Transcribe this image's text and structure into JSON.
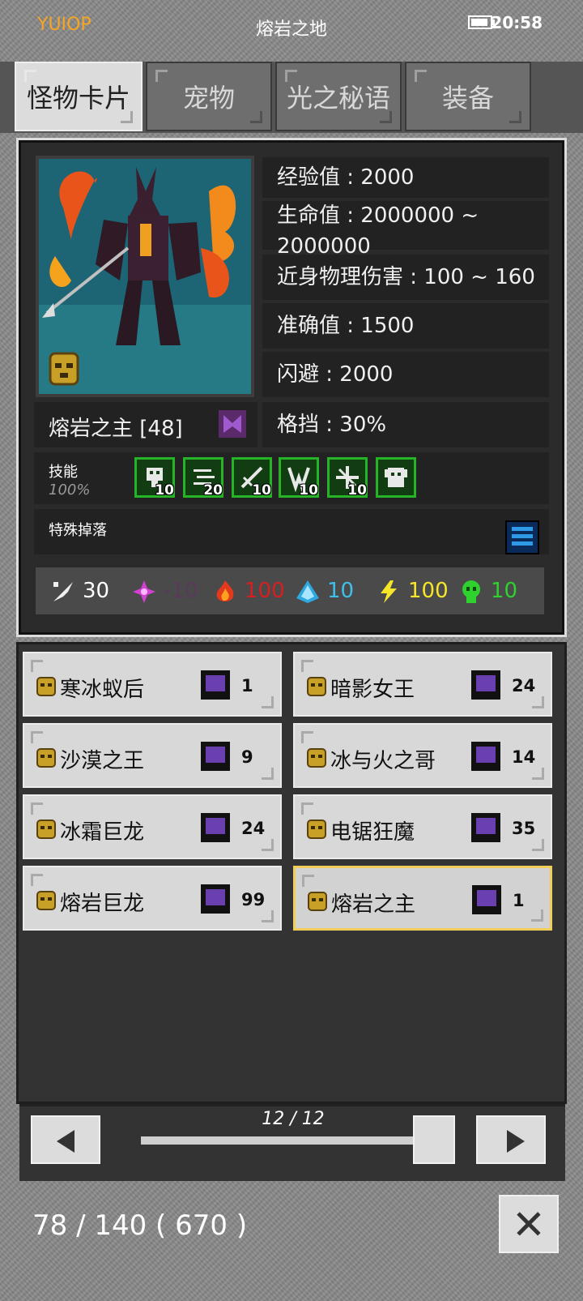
{
  "status": {
    "app": "YUIOP",
    "title": "熔岩之地",
    "time": "20:58"
  },
  "tabs": [
    {
      "label": "怪物卡片",
      "active": true
    },
    {
      "label": "宠物",
      "active": false
    },
    {
      "label": "光之秘语",
      "active": false
    },
    {
      "label": "装备",
      "active": false
    }
  ],
  "monster": {
    "name": "熔岩之主 [48]",
    "stats": {
      "exp": "经验值 : 2000",
      "hp": "生命值 : 2000000 ~",
      "hp2": "2000000",
      "melee": "近身物理伤害 : 100 ~ 160",
      "accuracy": "准确值 : 1500",
      "dodge": "闪避 : 2000",
      "block": "格挡 : 30%"
    },
    "skills_label": "技能",
    "skills_pct": "100%",
    "skills": [
      {
        "icon": "skill-ghost-icon",
        "level": "10"
      },
      {
        "icon": "skill-speed-icon",
        "level": "20"
      },
      {
        "icon": "skill-sword-icon",
        "level": "10"
      },
      {
        "icon": "skill-split-icon",
        "level": "10"
      },
      {
        "icon": "skill-cross-icon",
        "level": "10"
      },
      {
        "icon": "skill-armor-icon",
        "level": ""
      }
    ],
    "drops_label": "特殊掉落",
    "resist": [
      {
        "icon": "physical-icon",
        "value": "30",
        "color": "#ffffff"
      },
      {
        "icon": "arcane-icon",
        "value": "-10",
        "color": "#5a3a5a"
      },
      {
        "icon": "fire-icon",
        "value": "100",
        "color": "#d62020"
      },
      {
        "icon": "ice-icon",
        "value": "10",
        "color": "#3fc0e8"
      },
      {
        "icon": "lightning-icon",
        "value": "100",
        "color": "#f5e62a"
      },
      {
        "icon": "poison-icon",
        "value": "10",
        "color": "#2ed12e"
      }
    ]
  },
  "list": [
    {
      "name": "寒冰蚁后",
      "count": "1"
    },
    {
      "name": "暗影女王",
      "count": "24"
    },
    {
      "name": "沙漠之王",
      "count": "9"
    },
    {
      "name": "冰与火之哥",
      "count": "14"
    },
    {
      "name": "冰霜巨龙",
      "count": "24"
    },
    {
      "name": "电锯狂魔",
      "count": "35"
    },
    {
      "name": "熔岩巨龙",
      "count": "99"
    },
    {
      "name": "熔岩之主",
      "count": "1",
      "selected": true
    }
  ],
  "pager": {
    "text": "12 / 12"
  },
  "footer": {
    "collection": "78 / 140 ( 670 )"
  }
}
